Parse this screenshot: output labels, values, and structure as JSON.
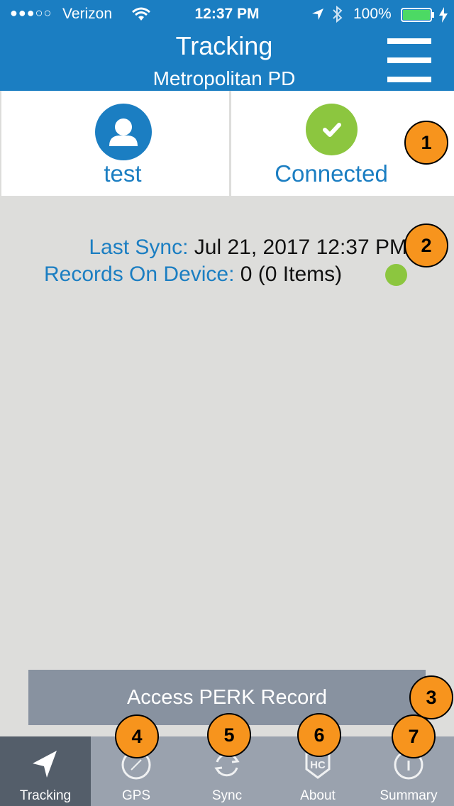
{
  "status_bar": {
    "signal_dots": "●●●○○",
    "carrier": "Verizon",
    "time": "12:37 PM",
    "battery": "100%"
  },
  "header": {
    "title": "Tracking",
    "subtitle": "Metropolitan PD"
  },
  "user": {
    "name": "test"
  },
  "connection": {
    "status": "Connected"
  },
  "sync": {
    "last_sync_label": "Last Sync:",
    "last_sync_value": "Jul 21, 2017 12:37 PM",
    "records_label": "Records On Device:",
    "records_value": "0 (0 Items)"
  },
  "perk_button": {
    "label": "Access PERK Record"
  },
  "tabs": [
    {
      "label": "Tracking",
      "icon": "location-arrow-icon",
      "active": true
    },
    {
      "label": "GPS",
      "icon": "compass-icon",
      "active": false
    },
    {
      "label": "Sync",
      "icon": "sync-icon",
      "active": false
    },
    {
      "label": "About",
      "icon": "hc-badge-icon",
      "active": false
    },
    {
      "label": "Summary",
      "icon": "info-icon",
      "active": false
    }
  ],
  "callouts": [
    "1",
    "2",
    "3",
    "4",
    "5",
    "6",
    "7"
  ],
  "colors": {
    "header_blue": "#1b7ec2",
    "connected_green": "#8cc63f",
    "callout_orange": "#f7941d",
    "tabbar": "#9aa2ae",
    "tab_active": "#545e6a",
    "button_gray": "#8892a0",
    "background": "#dddddb"
  }
}
